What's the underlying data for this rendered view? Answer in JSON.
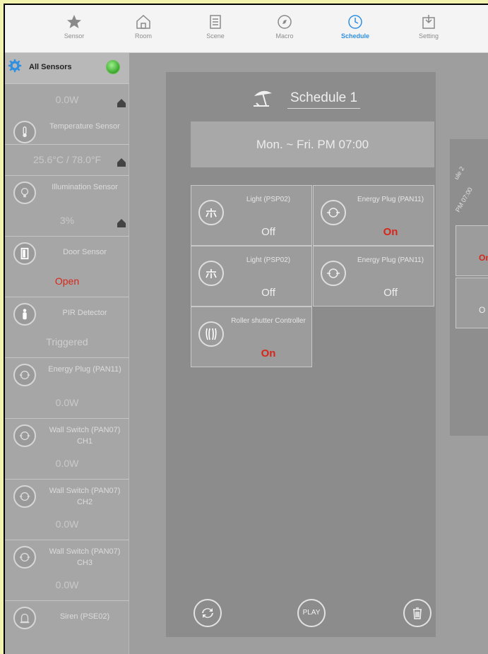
{
  "nav": {
    "tabs": [
      {
        "label": "Sensor",
        "icon": "star-icon"
      },
      {
        "label": "Room",
        "icon": "house-icon"
      },
      {
        "label": "Scene",
        "icon": "list-icon"
      },
      {
        "label": "Macro",
        "icon": "compass-icon"
      },
      {
        "label": "Schedule",
        "icon": "clock-icon",
        "active": true
      },
      {
        "label": "Setting",
        "icon": "download-icon"
      }
    ],
    "active_color": "#2f8fe0"
  },
  "sidebar": {
    "header": {
      "title": "All Sensors",
      "status_color": "#3aa62e"
    },
    "items": [
      {
        "name": "",
        "value": "0.0W",
        "icon": "none"
      },
      {
        "name": "Temperature Sensor",
        "value": "25.6°C / 78.0°F",
        "icon": "thermometer-icon"
      },
      {
        "name": "Illumination Sensor",
        "value": "3%",
        "icon": "bulb-icon"
      },
      {
        "name": "Door Sensor",
        "value": "Open",
        "icon": "door-icon"
      },
      {
        "name": "PIR Detector",
        "value": "Triggered",
        "icon": "person-icon"
      },
      {
        "name": "Energy Plug (PAN11)",
        "value": "0.0W",
        "icon": "plug-icon"
      },
      {
        "name": "Wall Switch (PAN07) CH1",
        "value": "0.0W",
        "icon": "plug-icon"
      },
      {
        "name": "Wall Switch (PAN07) CH2",
        "value": "0.0W",
        "icon": "plug-icon"
      },
      {
        "name": "Wall Switch (PAN07) CH3",
        "value": "0.0W",
        "icon": "plug-icon"
      },
      {
        "name": "Siren (PSE02)",
        "value": "",
        "icon": "siren-icon"
      }
    ]
  },
  "schedule": {
    "title": "Schedule 1",
    "time": "Mon. ~ Fri.  PM 07:00",
    "devices": [
      {
        "name": "Light (PSP02)",
        "state": "Off",
        "icon": "light-icon"
      },
      {
        "name": "Energy Plug (PAN11)",
        "state": "On",
        "icon": "plug-icon"
      },
      {
        "name": "Light (PSP02)",
        "state": "Off",
        "icon": "light-icon"
      },
      {
        "name": "Energy Plug (PAN11)",
        "state": "Off",
        "icon": "plug-icon"
      },
      {
        "name": "Roller shutter Controller",
        "state": "On",
        "icon": "shutter-icon"
      }
    ],
    "buttons": {
      "refresh": "refresh-icon",
      "play": "PLAY",
      "trash": "trash-icon"
    }
  },
  "back_card": {
    "title_fragment": "ule 2",
    "time_fragment": "PM 07:00",
    "states": [
      "On",
      "O"
    ]
  }
}
